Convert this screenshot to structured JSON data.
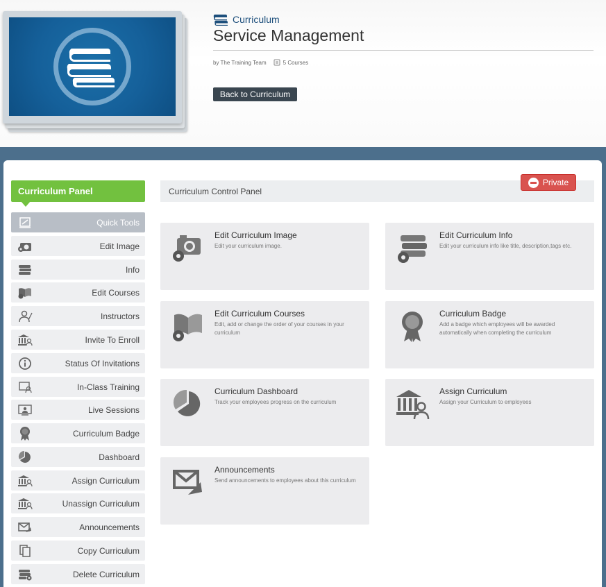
{
  "header": {
    "category": "Curriculum",
    "title": "Service Management",
    "author": "by The Training Team",
    "courses": "5 Courses",
    "back_button": "Back to Curriculum"
  },
  "sidebar": {
    "title": "Curriculum Panel",
    "items": [
      {
        "label": "Quick Tools",
        "icon": "quick-tools-icon"
      },
      {
        "label": "Edit Image",
        "icon": "camera-gear-icon"
      },
      {
        "label": "Info",
        "icon": "books-icon"
      },
      {
        "label": "Edit Courses",
        "icon": "open-book-gear-icon"
      },
      {
        "label": "Instructors",
        "icon": "instructor-icon"
      },
      {
        "label": "Invite To Enroll",
        "icon": "building-user-icon"
      },
      {
        "label": "Status Of Invitations",
        "icon": "info-icon"
      },
      {
        "label": "In-Class Training",
        "icon": "classroom-icon"
      },
      {
        "label": "Live Sessions",
        "icon": "live-session-icon"
      },
      {
        "label": "Curriculum Badge",
        "icon": "badge-icon"
      },
      {
        "label": "Dashboard",
        "icon": "pie-chart-icon"
      },
      {
        "label": "Assign Curriculum",
        "icon": "building-user-icon"
      },
      {
        "label": "Unassign Curriculum",
        "icon": "building-user-icon"
      },
      {
        "label": "Announcements",
        "icon": "envelope-arrow-icon"
      },
      {
        "label": "Copy Curriculum",
        "icon": "copy-icon"
      },
      {
        "label": "Delete Curriculum",
        "icon": "books-delete-icon"
      }
    ]
  },
  "control_panel": {
    "title": "Curriculum Control Panel",
    "private_label": "Private",
    "tiles": [
      {
        "title": "Edit Curriculum Image",
        "desc": "Edit your curriculum image.",
        "icon": "camera-gear-icon"
      },
      {
        "title": "Edit Curriculum Info",
        "desc": "Edit your curriculum info like title, description,tags etc.",
        "icon": "books-gear-icon"
      },
      {
        "title": "Edit Curriculum Courses",
        "desc": "Edit, add or change the order of your courses in your curriculum",
        "icon": "open-book-gear-icon"
      },
      {
        "title": "Curriculum Badge",
        "desc": "Add a badge which employees will be awarded automatically when completing the curriculum",
        "icon": "badge-icon"
      },
      {
        "title": "Curriculum Dashboard",
        "desc": "Track your employees progress on the curriculum",
        "icon": "pie-chart-icon"
      },
      {
        "title": "Assign Curriculum",
        "desc": "Assign your Curriculum to employees",
        "icon": "building-user-icon"
      },
      {
        "title": "Announcements",
        "desc": "Send announcements to employees about this curriculum",
        "icon": "envelope-arrow-icon"
      }
    ]
  },
  "colors": {
    "accent_green": "#72c13f",
    "band_blue": "#4c6f8c",
    "private_red": "#d9534f",
    "button_dark": "#3a4650"
  }
}
